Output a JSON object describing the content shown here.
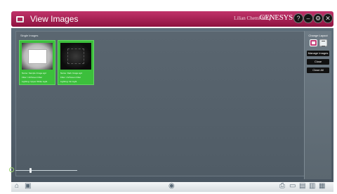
{
  "window": {
    "title": "View Images",
    "user": "Lilian Chemi-HIQ",
    "brand": "GENESYS",
    "buttons": [
      {
        "name": "help-button",
        "glyph": "?"
      },
      {
        "name": "minimize-button",
        "glyph": "–"
      },
      {
        "name": "settings-button",
        "glyph": "⚙"
      },
      {
        "name": "close-button",
        "glyph": "✕"
      }
    ]
  },
  "panel": {
    "label": "Single Images",
    "images": [
      {
        "style": "light",
        "rows": [
          [
            "Name:",
            "Sample Image.sgd"
          ],
          [
            "Filter:",
            "UV/Green Filter"
          ],
          [
            "Lighting:",
            "Upper White Light"
          ]
        ]
      },
      {
        "style": "dark",
        "rows": [
          [
            "Name:",
            "Dark Image.sgd"
          ],
          [
            "Filter:",
            "UV/Green Filter"
          ],
          [
            "Lighting:",
            "No Light"
          ]
        ]
      }
    ]
  },
  "zoom": {
    "level": 0.24
  },
  "sidebar": {
    "change_layout_label": "Change Layout",
    "manage_images_label": "Manage Images",
    "close_label": "Close",
    "close_all_label": "Close All"
  },
  "bottombar": {
    "left_icons": [
      "home-icon",
      "capture-icon"
    ],
    "center_icon": "analysis-icon",
    "right_icons": [
      "print-icon",
      "monitor-icon",
      "document-icon",
      "chart-icon",
      "gallery-icon"
    ]
  }
}
